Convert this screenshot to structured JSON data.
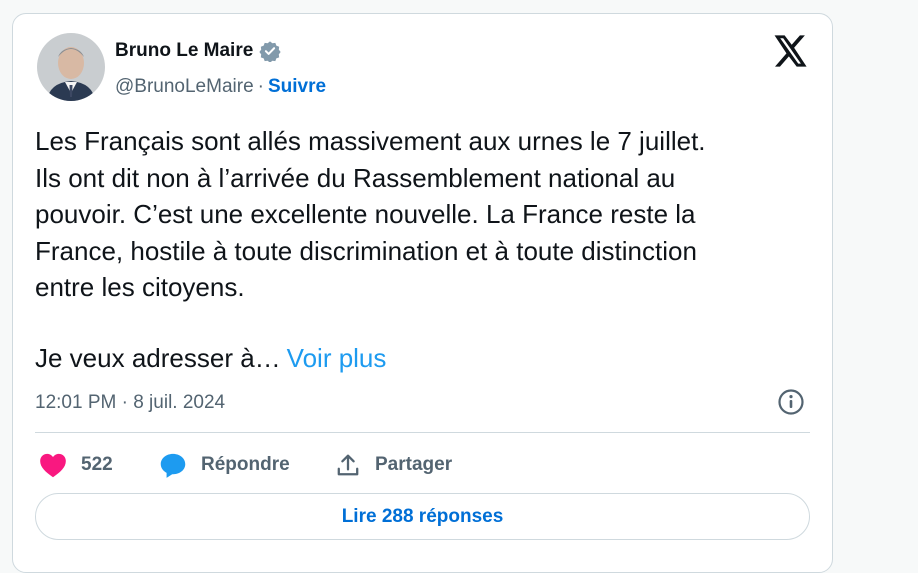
{
  "author": {
    "name": "Bruno Le Maire",
    "handle": "@BrunoLeMaire",
    "separator": "·",
    "follow_label": "Suivre",
    "verified_color": "#829aab"
  },
  "tweet": {
    "text": "Les Français sont allés massivement aux urnes le 7 juillet.\nIls ont dit non à l’arrivée du Rassemblement national au\npouvoir. C’est une excellente nouvelle. La France reste la\nFrance, hostile à toute discrimination et à toute distinction\nentre les citoyens.",
    "truncated_text": "Je veux adresser à…",
    "more_label": "Voir plus",
    "timestamp": "12:01 PM · 8 juil. 2024"
  },
  "actions": {
    "like_count": "522",
    "reply_label": "Répondre",
    "share_label": "Partager"
  },
  "read_replies_label": "Lire 288 réponses",
  "colors": {
    "like": "#f91880",
    "reply_icon": "#1d9bf0",
    "link": "#006fd6",
    "more_link": "#1d9bf0"
  },
  "icons": {
    "brand": "x-logo-icon",
    "like": "heart-icon",
    "reply": "speech-bubble-icon",
    "share": "share-icon",
    "info": "info-icon",
    "verified": "verified-badge-icon"
  }
}
